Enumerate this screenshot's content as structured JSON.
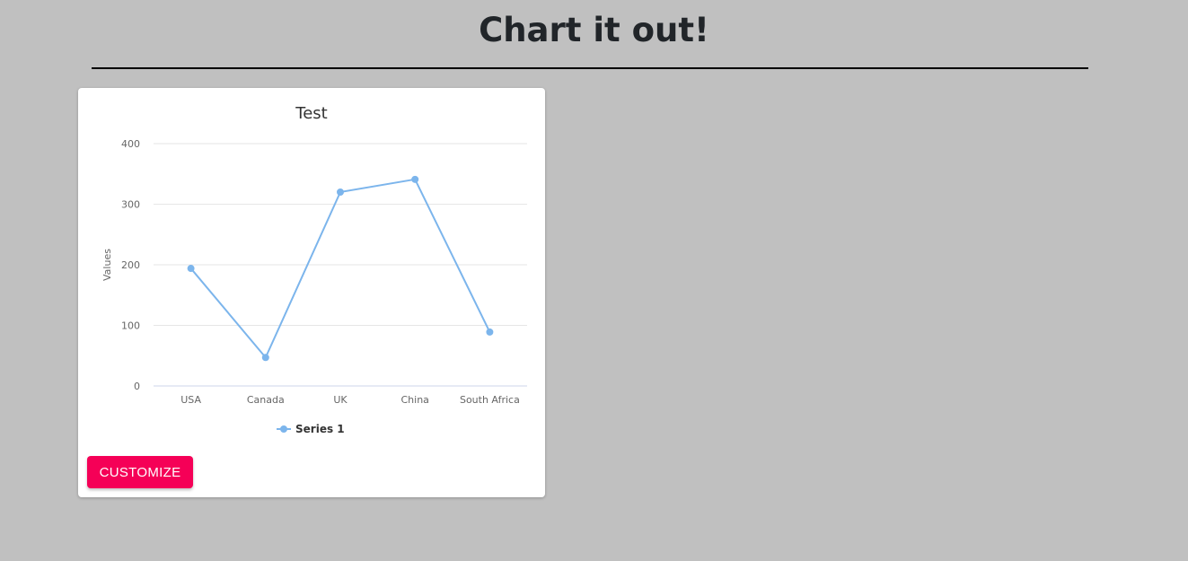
{
  "header": {
    "title": "Chart it out!"
  },
  "card": {
    "customize_label": "CUSTOMIZE"
  },
  "colors": {
    "background": "#c0c0c0",
    "series": "#7cb5ec",
    "button": "#f50057"
  },
  "chart_data": {
    "type": "line",
    "title": "Test",
    "xlabel": "",
    "ylabel": "Values",
    "categories": [
      "USA",
      "Canada",
      "UK",
      "China",
      "South Africa"
    ],
    "series": [
      {
        "name": "Series 1",
        "values": [
          194,
          47,
          320,
          341,
          89
        ]
      }
    ],
    "ylim": [
      0,
      400
    ],
    "yticks": [
      0,
      100,
      200,
      300,
      400
    ],
    "grid": true,
    "legend": "bottom-center"
  }
}
